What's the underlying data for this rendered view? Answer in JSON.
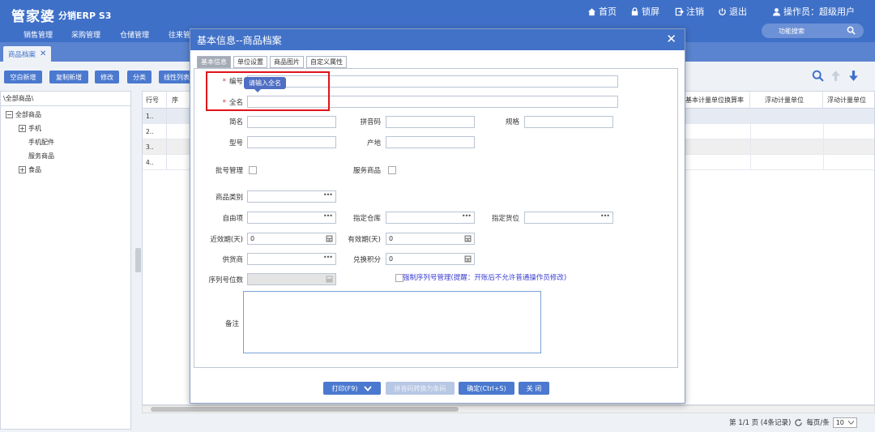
{
  "app": {
    "logo": "管家婆",
    "logo_sub": "分销ERP S3",
    "nav": {
      "home": "首页",
      "lock": "锁屏",
      "logout": "注销",
      "exit": "退出",
      "operator": "操作员：超级用户"
    },
    "menu": [
      "销售管理",
      "采购管理",
      "仓储管理",
      "往来管"
    ],
    "func_search": "功能搜索"
  },
  "open_tab": "商品档案",
  "toolbar": {
    "buttons": [
      "空白新增",
      "复制新增",
      "修改",
      "分类",
      "线性列表"
    ]
  },
  "tree": {
    "header": "\\全部商品\\",
    "nodes": [
      {
        "label": "全部商品",
        "expander": "⊟"
      },
      {
        "label": "手机",
        "expander": "⊞"
      },
      {
        "label": "手机配件",
        "expander": ""
      },
      {
        "label": "服务商品",
        "expander": ""
      },
      {
        "label": "食品",
        "expander": "⊞"
      }
    ]
  },
  "grid": {
    "headers": [
      "行号",
      "序",
      "基本计量单位换算率",
      "浮动计量单位",
      "浮动计量单位"
    ],
    "rows": [
      "1..",
      "2..",
      "3..",
      "4.."
    ]
  },
  "pager": {
    "text": "第 1/1 页 (4条记录)",
    "per_page_label": "每页/条",
    "per_page_value": "10"
  },
  "dialog": {
    "title": "基本信息--商品档案",
    "close": "✕",
    "tabs": [
      "基本信息",
      "单位设置",
      "商品图片",
      "自定义属性"
    ],
    "tooltip": "请输入全名",
    "labels": {
      "code": "编号",
      "fullname": "全名",
      "shortname": "简名",
      "barcode": "拼音码",
      "spec": "规格",
      "model": "型号",
      "origin": "产地",
      "batch": "批号管理",
      "service": "服务商品",
      "category": "商品类别",
      "custom": "自由项",
      "warehouse": "指定仓库",
      "location": "指定货位",
      "near_expiry": "近效期(天)",
      "expiry": "有效期(天)",
      "supplier": "供货商",
      "points": "兑换积分",
      "serial_digits": "序列号位数",
      "remark": "备注"
    },
    "values": {
      "near_expiry": "0",
      "expiry": "0",
      "points": "0"
    },
    "serial_warning": "强制序列号管理(提醒：开账后不允许普通操作员修改)",
    "footer": {
      "print": "打印(F9)",
      "convert": "拼音码转换为条码",
      "confirm": "确定(Ctrl+S)",
      "close": "关 闭"
    }
  }
}
